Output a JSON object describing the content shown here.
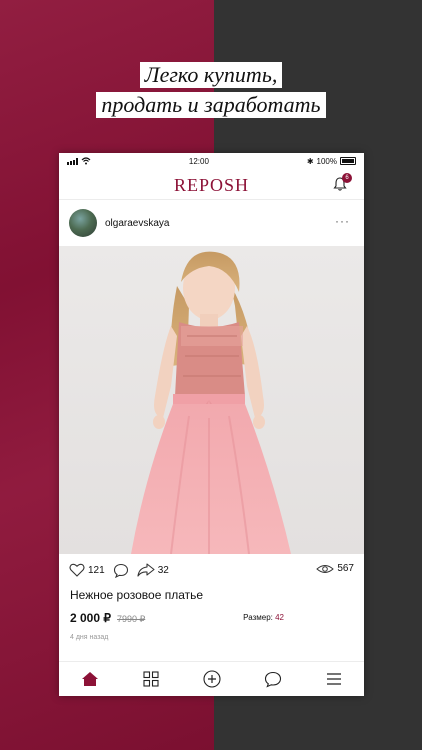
{
  "headline": {
    "line1": "Легко купить,",
    "line2": "продать и заработать"
  },
  "status_bar": {
    "time": "12:00",
    "battery": "100%"
  },
  "app": {
    "logo": "REPOSH",
    "notification_count": "6"
  },
  "post": {
    "username": "olgaraevskaya",
    "more_label": "···",
    "likes": "121",
    "shares": "32",
    "views": "567",
    "title": "Нежное розовое платье",
    "price": "2 000 ₽",
    "old_price": "7990 ₽",
    "size_label": "Размер:",
    "size_value": "42",
    "time_ago": "4 дня назад"
  },
  "tabs": [
    {
      "name": "home",
      "icon": "home-icon",
      "active": true
    },
    {
      "name": "catalog",
      "icon": "grid-icon",
      "active": false
    },
    {
      "name": "add",
      "icon": "plus-circle-icon",
      "active": false
    },
    {
      "name": "messages",
      "icon": "chat-icon",
      "active": false
    },
    {
      "name": "menu",
      "icon": "menu-icon",
      "active": false
    }
  ],
  "colors": {
    "brand": "#8c1237",
    "dark_bg": "#333333"
  }
}
